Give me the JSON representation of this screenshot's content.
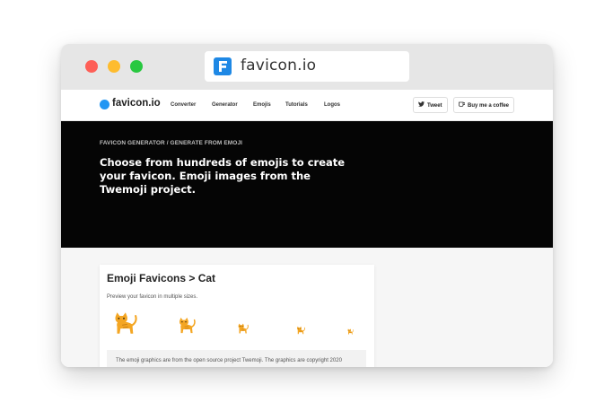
{
  "browser": {
    "url_text": "favicon.io",
    "colors": {
      "close": "#fe5f57",
      "minimize": "#febc2e",
      "maximize": "#28c840"
    }
  },
  "header": {
    "brand": "favicon.io",
    "nav": [
      "Converter",
      "Generator",
      "Emojis",
      "Tutorials",
      "Logos"
    ],
    "tweet_label": "Tweet",
    "coffee_label": "Buy me a coffee"
  },
  "hero": {
    "breadcrumb": "FAVICON GENERATOR / GENERATE FROM EMOJI",
    "title": "Choose from hundreds of emojis to create your favicon. Emoji images from the Twemoji project."
  },
  "card": {
    "title": "Emoji Favicons > Cat",
    "description": "Preview your favicon in multiple sizes.",
    "note": "The emoji graphics are from the open source project Twemoji. The graphics are copyright 2020"
  },
  "icons": {
    "favicon": "favicon-f-icon",
    "brand": "blue-dot-icon",
    "tweet": "twitter-bird-icon",
    "coffee": "coffee-cup-icon",
    "preview": "cat-emoji-icon"
  },
  "colors": {
    "brand_blue": "#2196f3",
    "hero_bg": "#050505",
    "cat": "#f4a623"
  }
}
